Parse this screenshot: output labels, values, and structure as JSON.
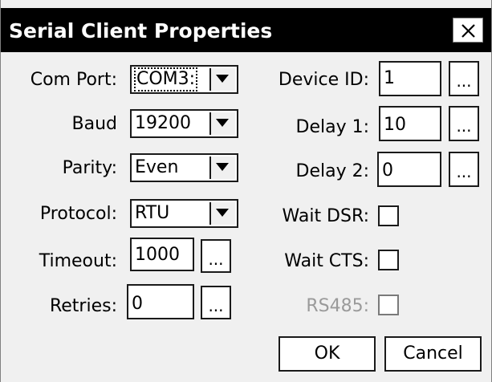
{
  "dialog": {
    "title": "Serial Client Properties",
    "close_glyph": "×"
  },
  "left": {
    "com_port": {
      "label": "Com Port:",
      "value": "COM3:"
    },
    "baud": {
      "label": "Baud",
      "value": "19200"
    },
    "parity": {
      "label": "Parity:",
      "value": "Even"
    },
    "protocol": {
      "label": "Protocol:",
      "value": "RTU"
    },
    "timeout": {
      "label": "Timeout:",
      "value": "1000",
      "browse": "..."
    },
    "retries": {
      "label": "Retries:",
      "value": "0",
      "browse": "..."
    }
  },
  "right": {
    "device_id": {
      "label": "Device ID:",
      "value": "1",
      "browse": "..."
    },
    "delay1": {
      "label": "Delay 1:",
      "value": "10",
      "browse": "..."
    },
    "delay2": {
      "label": "Delay 2:",
      "value": "0",
      "browse": "..."
    },
    "wait_dsr": {
      "label": "Wait DSR:",
      "checked": false
    },
    "wait_cts": {
      "label": "Wait CTS:",
      "checked": false
    },
    "rs485": {
      "label": "RS485:",
      "checked": false,
      "disabled": true
    }
  },
  "buttons": {
    "ok": "OK",
    "cancel": "Cancel"
  },
  "icons": {
    "close": "close-icon",
    "dropdown": "triangle-down-icon"
  }
}
